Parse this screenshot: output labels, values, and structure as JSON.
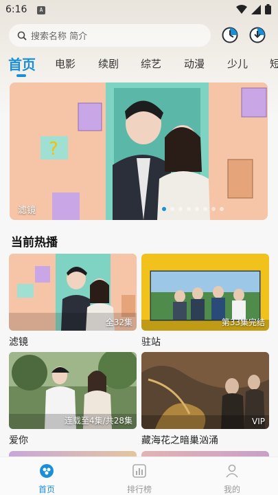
{
  "status": {
    "time": "6:16",
    "notify_glyph": "A"
  },
  "search": {
    "placeholder": "搜索名称 简介"
  },
  "header_icons": [
    "history-clock-icon",
    "download-clock-icon"
  ],
  "tabs": [
    {
      "label": "首页",
      "active": true
    },
    {
      "label": "电影"
    },
    {
      "label": "续剧"
    },
    {
      "label": "综艺"
    },
    {
      "label": "动漫"
    },
    {
      "label": "少儿"
    },
    {
      "label": "短"
    }
  ],
  "banner": {
    "title": "滤镜",
    "slide_count": 8,
    "active_slide": 0
  },
  "section": {
    "title": "当前热播"
  },
  "cards": [
    {
      "title": "滤镜",
      "badge": "全32集"
    },
    {
      "title": "驻站",
      "badge": "第33集完结"
    },
    {
      "title": "爱你",
      "badge": "连载至4集/共28集"
    },
    {
      "title": "藏海花之暗巢汹涌",
      "badge": "VIP"
    }
  ],
  "bottom_nav": [
    {
      "label": "首页",
      "icon": "home-icon",
      "active": true
    },
    {
      "label": "排行榜",
      "icon": "ranking-icon"
    },
    {
      "label": "我的",
      "icon": "profile-icon"
    }
  ],
  "colors": {
    "accent": "#1a8fd8"
  }
}
